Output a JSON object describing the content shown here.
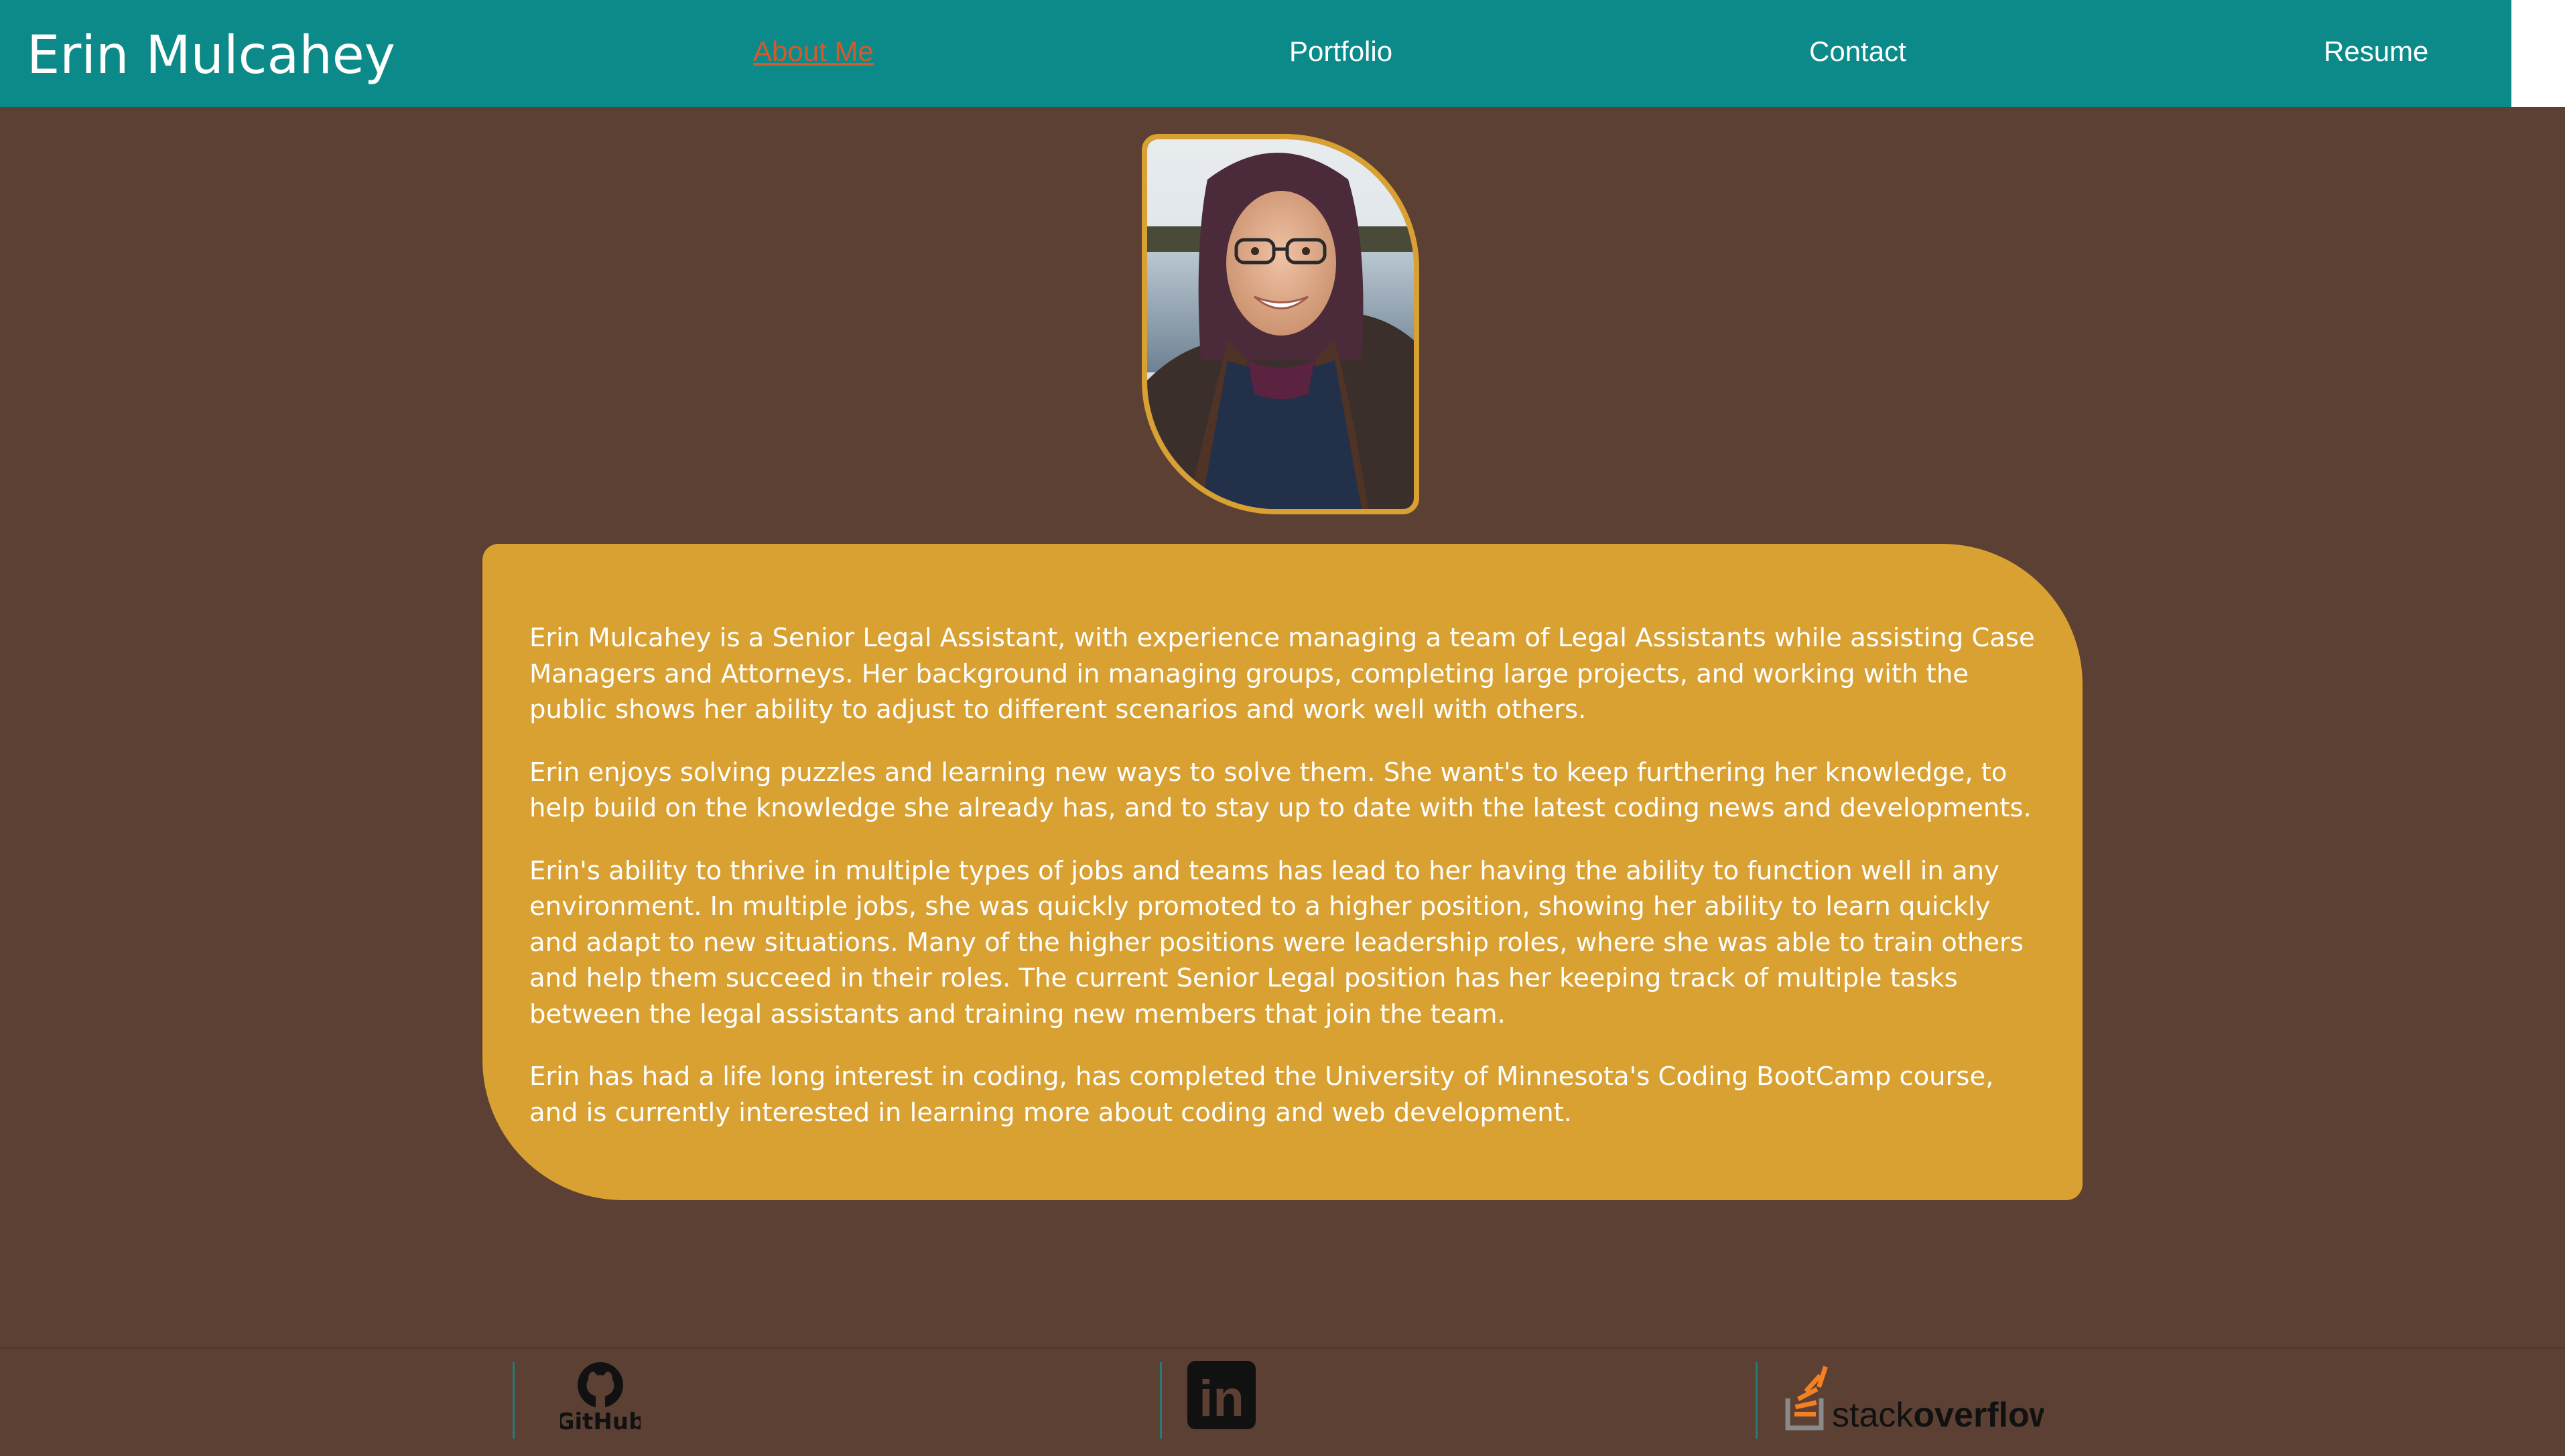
{
  "site": {
    "brand": "Erin Mulcahey"
  },
  "nav": {
    "items": [
      {
        "label": "About Me",
        "active": true
      },
      {
        "label": "Portfolio",
        "active": false
      },
      {
        "label": "Contact",
        "active": false
      },
      {
        "label": "Resume",
        "active": false
      }
    ]
  },
  "profile_photo": {
    "alt": "Erin Mulcahey"
  },
  "bio": {
    "paragraphs": [
      "Erin Mulcahey is a Senior Legal Assistant, with experience managing a team of Legal Assistants while assisting Case Managers and Attorneys. Her background in managing groups, completing large projects, and working with the public shows her ability to adjust to different scenarios and work well with others.",
      "Erin enjoys solving puzzles and learning new ways to solve them. She want's to keep furthering her knowledge, to help build on the knowledge she already has, and to stay up to date with the latest coding news and developments.",
      "Erin's ability to thrive in multiple types of jobs and teams has lead to her having the ability to function well in any environment. In multiple jobs, she was quickly promoted to a higher position, showing her ability to learn quickly and adapt to new situations. Many of the higher positions were leadership roles, where she was able to train others and help them succeed in their roles. The current Senior Legal position has her keeping track of multiple tasks between the legal assistants and training new members that join the team.",
      "Erin has had a life long interest in coding, has completed the University of Minnesota's Coding BootCamp course, and is currently interested in learning more about coding and web development."
    ]
  },
  "footer": {
    "github_label": "GitHub",
    "linkedin_label": "in",
    "stackoverflow_prefix": "stack",
    "stackoverflow_suffix": "overflow"
  },
  "colors": {
    "navbar": "#0c8a8a",
    "background": "#5c4033",
    "accent": "#d9a032",
    "active_link": "#d45a2b"
  }
}
